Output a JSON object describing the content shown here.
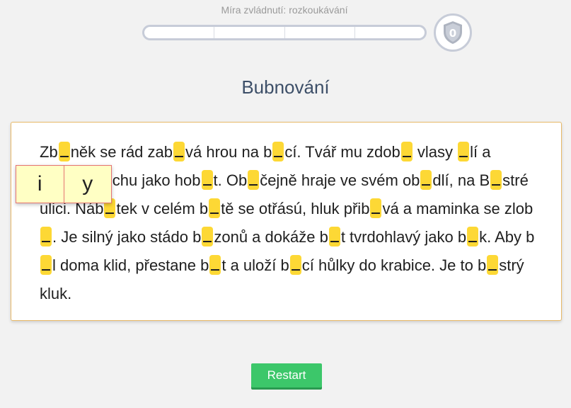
{
  "mastery": {
    "label": "Míra zvládnutí: rozkoukávání",
    "progress": 0,
    "badge_value": "0"
  },
  "title": "Bubnování",
  "choices": {
    "option_i": "i",
    "option_y": "y"
  },
  "text_segments": [
    "Zb",
    "něk se rád zab",
    "vá hrou na b",
    "cí. Tvář mu zdob",
    " vlasy ",
    "lí a vypadá trochu jako hob",
    "t. Ob",
    "čejně hraje ve svém ob",
    "dlí, na B",
    "stré ulici. Náb",
    "tek v celém b",
    "tě se otřású, hluk přib",
    "vá a maminka se zlob",
    ". Je silný jako stádo b",
    "zonů a dokáže b",
    "t tvrdohlavý jako b",
    "k. Aby b",
    "l doma klid, přestane b",
    "t a uloží b",
    "cí hůlky do krabice. Je to b",
    "strý kluk."
  ],
  "actions": {
    "restart_label": "Restart"
  },
  "colors": {
    "gap": "#fdd835",
    "restart": "#3cc76a",
    "card_border": "#e8b968",
    "title": "#3d4f68"
  }
}
